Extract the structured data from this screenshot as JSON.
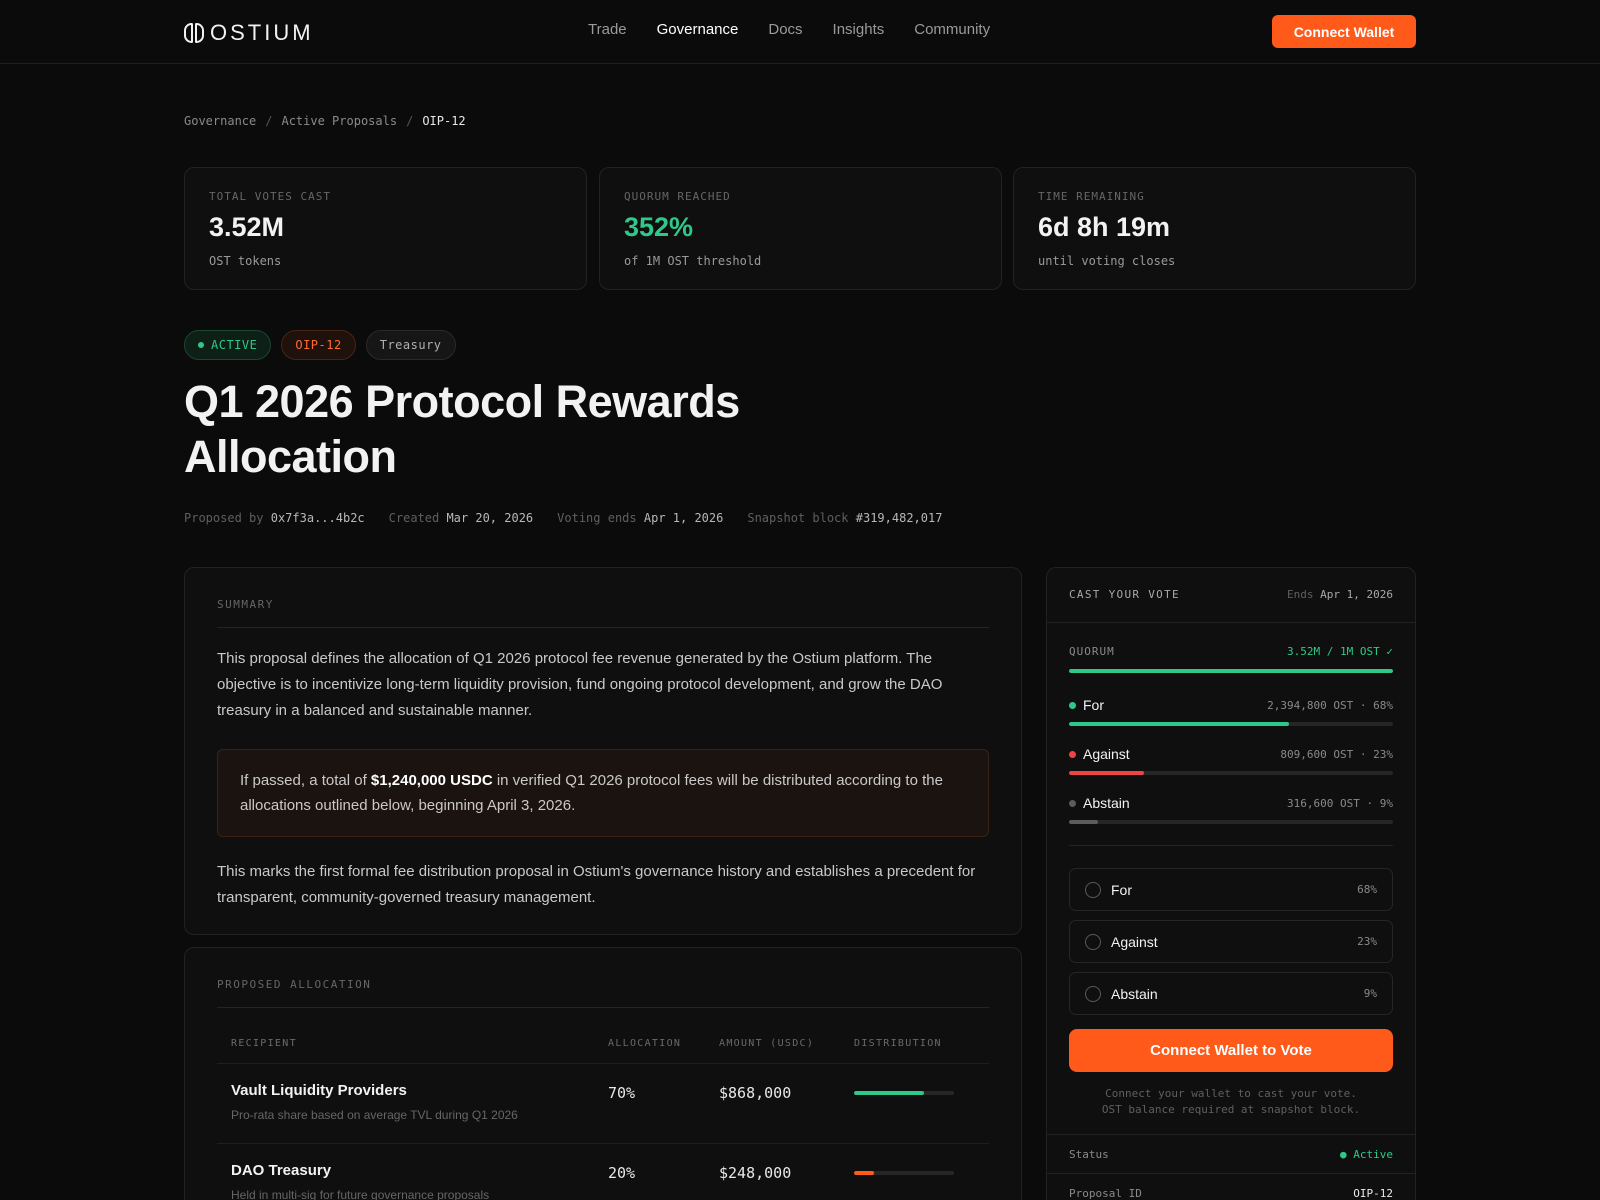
{
  "nav": {
    "logo": "OSTIUM",
    "links": [
      "Trade",
      "Governance",
      "Docs",
      "Insights",
      "Community"
    ],
    "active": "Governance",
    "connect_label": "Connect Wallet"
  },
  "breadcrumb": [
    "Governance",
    "Active Proposals",
    "OIP-12"
  ],
  "stats": [
    {
      "label": "TOTAL VOTES CAST",
      "value": "3.52M",
      "sub": "OST tokens"
    },
    {
      "label": "QUORUM REACHED",
      "value": "352%",
      "sub": "of 1M OST threshold",
      "accent": "#2ec98a"
    },
    {
      "label": "TIME REMAINING",
      "value": "6d 8h 19m",
      "sub": "until voting closes"
    }
  ],
  "badges": {
    "status": "ACTIVE",
    "id": "OIP-12",
    "category": "Treasury"
  },
  "title": "Q1 2026 Protocol Rewards Allocation",
  "meta": [
    {
      "k": "Proposed by",
      "v": "0x7f3a...4b2c"
    },
    {
      "k": "Created",
      "v": "Mar 20, 2026"
    },
    {
      "k": "Voting ends",
      "v": "Apr 1, 2026"
    },
    {
      "k": "Snapshot block",
      "v": "#319,482,017"
    }
  ],
  "summary": {
    "heading": "SUMMARY",
    "p1": "This proposal defines the allocation of Q1 2026 protocol fee revenue generated by the Ostium platform. The objective is to incentivize long-term liquidity provision, fund ongoing protocol development, and grow the DAO treasury in a balanced and sustainable manner.",
    "callout_pre": "If passed, a total of ",
    "callout_bold": "$1,240,000 USDC",
    "callout_post": " in verified Q1 2026 protocol fees will be distributed according to the allocations outlined below, beginning April 3, 2026.",
    "p2": "This marks the first formal fee distribution proposal in Ostium's governance history and establishes a precedent for transparent, community-governed treasury management."
  },
  "allocation": {
    "heading": "PROPOSED ALLOCATION",
    "columns": [
      "RECIPIENT",
      "ALLOCATION",
      "AMOUNT (USDC)",
      "DISTRIBUTION"
    ],
    "rows": [
      {
        "name": "Vault Liquidity Providers",
        "desc": "Pro-rata share based on average TVL during Q1 2026",
        "pct": "70%",
        "amount": "$868,000",
        "share": 0.7,
        "color": "#2ec98a"
      },
      {
        "name": "DAO Treasury",
        "desc": "Held in multi-sig for future governance proposals",
        "pct": "20%",
        "amount": "$248,000",
        "share": 0.2,
        "color": "#ff5a1a"
      }
    ]
  },
  "vote": {
    "heading": "CAST YOUR VOTE",
    "ends_label": "Ends",
    "ends_value": "Apr 1, 2026",
    "quorum_label": "QUORUM",
    "quorum_value": "3.52M / 1M OST ✓",
    "quorum_fill": 1.0,
    "results": [
      {
        "name": "For",
        "value": "2,394,800 OST · 68%",
        "share": 0.68,
        "color": "#2ec98a"
      },
      {
        "name": "Against",
        "value": "809,600 OST · 23%",
        "share": 0.23,
        "color": "#ef4444"
      },
      {
        "name": "Abstain",
        "value": "316,600 OST · 9%",
        "share": 0.09,
        "color": "#5c5c5c"
      }
    ],
    "options": [
      {
        "label": "For",
        "pct": "68%"
      },
      {
        "label": "Against",
        "pct": "23%"
      },
      {
        "label": "Abstain",
        "pct": "9%"
      }
    ],
    "button_label": "Connect Wallet to Vote",
    "note_1": "Connect your wallet to cast your vote.",
    "note_2": "OST balance required at snapshot block.",
    "details": [
      {
        "k": "Status",
        "v": "● Active"
      },
      {
        "k": "Proposal ID",
        "v": "OIP-12"
      }
    ]
  }
}
